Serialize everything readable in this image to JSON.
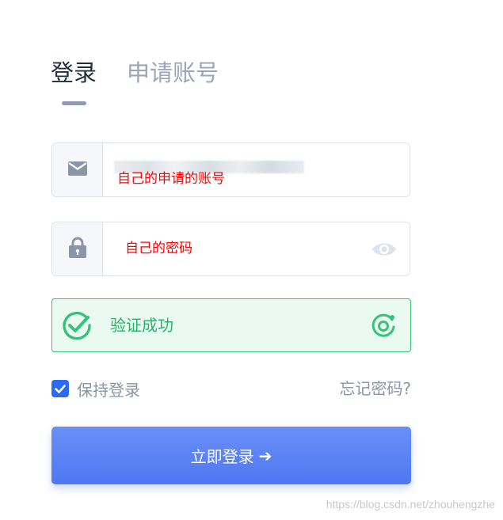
{
  "tabs": {
    "login": "登录",
    "apply": "申请账号"
  },
  "account": {
    "icon": "envelope-icon",
    "annotation": "自己的申请的账号"
  },
  "password": {
    "icon": "lock-icon",
    "annotation": "自己的密码",
    "toggle_icon": "eye-icon"
  },
  "captcha": {
    "status_icon": "check-circle-icon",
    "text": "验证成功",
    "refresh_icon": "refresh-icon"
  },
  "remember": {
    "label": "保持登录",
    "checked": true
  },
  "forgot": "忘记密码?",
  "submit": {
    "label": "立即登录",
    "arrow": "➔"
  },
  "watermark": "https://blog.csdn.net/zhouhengzhe",
  "colors": {
    "primary": "#4f78f2",
    "success": "#22b56a",
    "annotation": "#ff0000"
  }
}
